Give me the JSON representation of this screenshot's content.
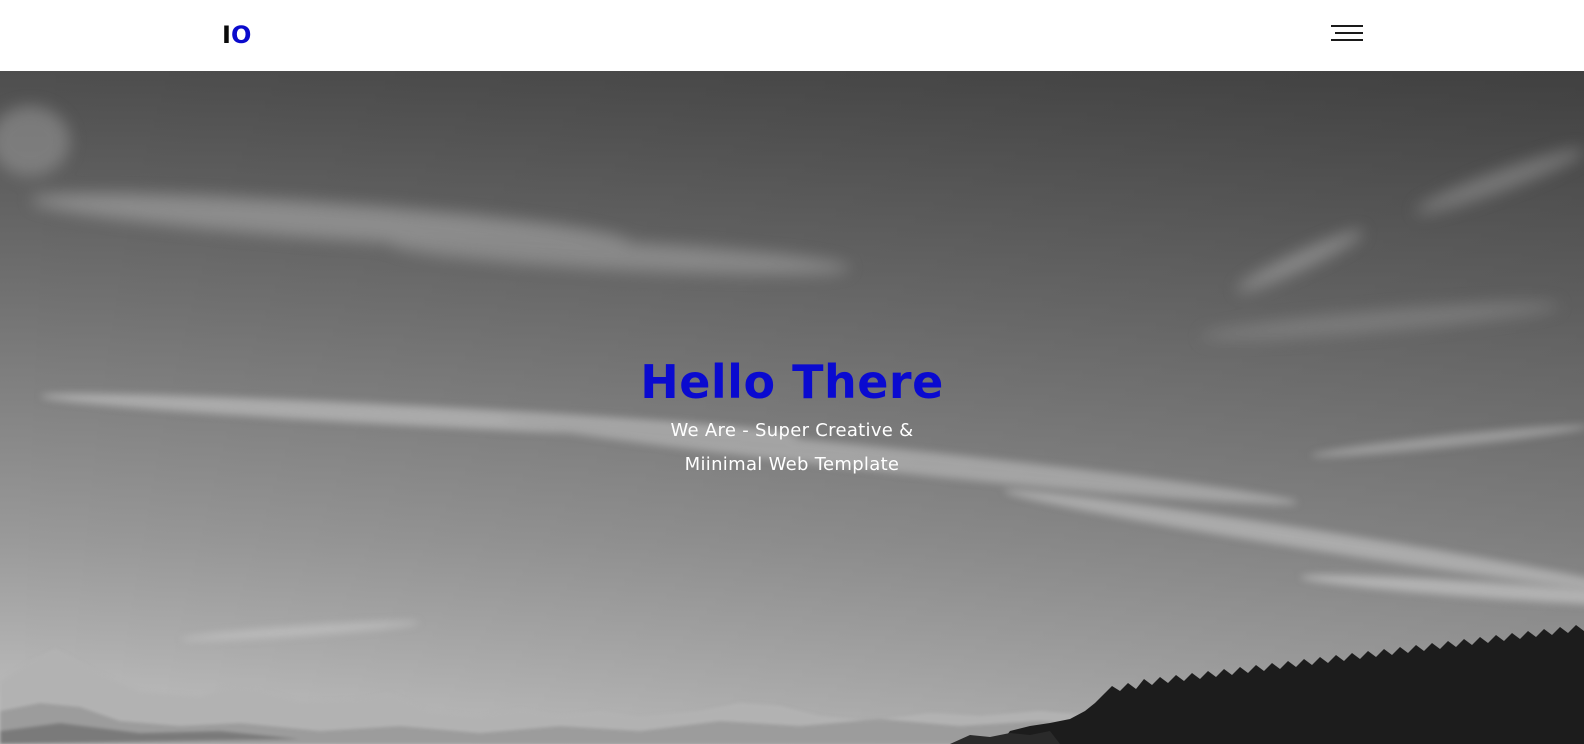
{
  "header": {
    "logo_part1": "I",
    "logo_part2": "O",
    "menu_icon": "hamburger-menu-icon"
  },
  "hero": {
    "title": "Hello There",
    "subtitle_line1": "We Are - Super Creative &",
    "subtitle_line2": "Miinimal Web Template",
    "background": "grayscale mountain landscape with cloudy sky"
  },
  "colors": {
    "accent": "#0a0acc",
    "logo_dark": "#0a0a0a",
    "header_bg": "#ffffff",
    "subtitle": "#ffffff"
  }
}
